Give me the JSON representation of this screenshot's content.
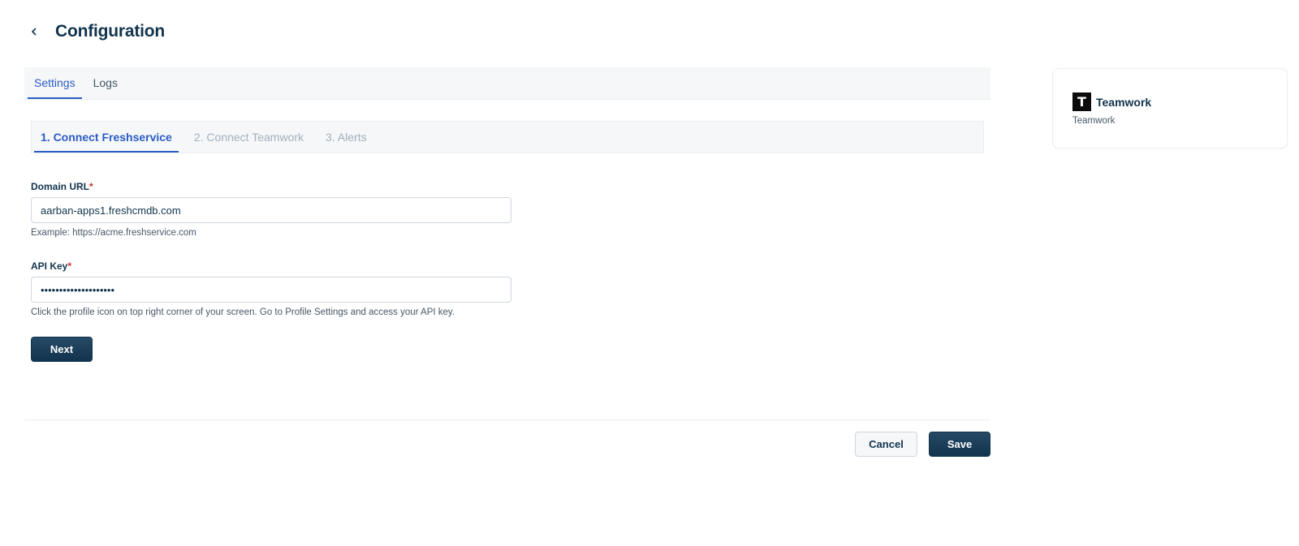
{
  "header": {
    "title": "Configuration",
    "back_icon": "chevron-left-icon"
  },
  "main_tabs": [
    {
      "label": "Settings",
      "active": true
    },
    {
      "label": "Logs",
      "active": false
    }
  ],
  "steps": [
    {
      "label": "1. Connect Freshservice",
      "active": true
    },
    {
      "label": "2. Connect Teamwork",
      "active": false
    },
    {
      "label": "3. Alerts",
      "active": false
    }
  ],
  "form": {
    "domain": {
      "label": "Domain URL",
      "required_mark": "*",
      "value": "aarban-apps1.freshcmdb.com",
      "hint": "Example: https://acme.freshservice.com"
    },
    "api_key": {
      "label": "API Key",
      "required_mark": "*",
      "value": "••••••••••••••••••••",
      "hint": "Click the profile icon on top right corner of your screen. Go to Profile Settings and access your API key."
    },
    "next_label": "Next"
  },
  "footer": {
    "cancel_label": "Cancel",
    "save_label": "Save"
  },
  "side_card": {
    "logo_letter": "T",
    "title": "Teamwork",
    "subtitle": "Teamwork"
  },
  "colors": {
    "accent": "#2c5cc5",
    "primary_button": "#12344d",
    "required": "#d72d30",
    "tab_bar_bg": "#f5f7f9"
  }
}
